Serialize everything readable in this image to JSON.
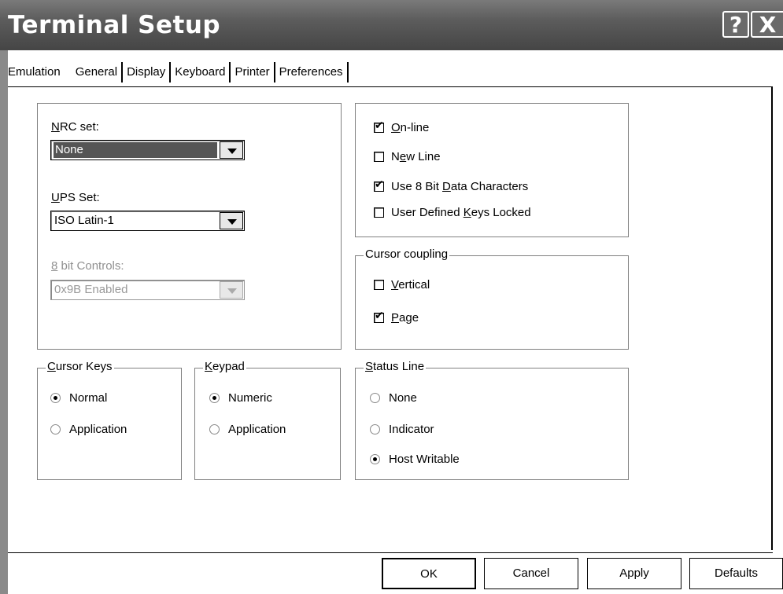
{
  "window": {
    "title": "Terminal Setup",
    "help_label": "?",
    "close_label": "X"
  },
  "tabs": [
    {
      "label": "Emulation",
      "selected": false
    },
    {
      "label": "General",
      "selected": true
    },
    {
      "label": "Display",
      "selected": false
    },
    {
      "label": "Keyboard",
      "selected": false
    },
    {
      "label": "Printer",
      "selected": false
    },
    {
      "label": "Preferences",
      "selected": false
    }
  ],
  "charset": {
    "nrc_label_u": "N",
    "nrc_label_rest": "RC set:",
    "nrc_value": "None",
    "ups_label_u": "U",
    "ups_label_rest": "PS Set:",
    "ups_value": "ISO Latin-1",
    "bit_label_u": "8",
    "bit_label_rest": " bit Controls:",
    "bit_value": "0x9B Enabled"
  },
  "options": {
    "online": {
      "u": "O",
      "rest": "n-line",
      "checked": true
    },
    "newline": {
      "pre": "N",
      "u": "e",
      "rest": "w Line",
      "checked": false
    },
    "use8bit": {
      "pre": "Use 8 Bit ",
      "u": "D",
      "rest": "ata Characters",
      "checked": true
    },
    "udk": {
      "pre": "User Defined ",
      "u": "K",
      "rest": "eys Locked",
      "checked": false
    }
  },
  "cursor_coupling": {
    "title": "Cursor coupling",
    "vertical": {
      "u": "V",
      "rest": "ertical",
      "checked": false
    },
    "page": {
      "u": "P",
      "rest": "age",
      "checked": true
    }
  },
  "cursor_keys": {
    "title_u": "C",
    "title_rest": "ursor Keys",
    "options": [
      {
        "label": "Normal",
        "selected": true
      },
      {
        "label": "Application",
        "selected": false
      }
    ]
  },
  "keypad": {
    "title_u": "K",
    "title_rest": "eypad",
    "options": [
      {
        "label": "Numeric",
        "selected": true
      },
      {
        "label": "Application",
        "selected": false
      }
    ]
  },
  "status_line": {
    "title_u": "S",
    "title_rest": "tatus Line",
    "options": [
      {
        "label": "None",
        "selected": false
      },
      {
        "label": "Indicator",
        "selected": false
      },
      {
        "label": "Host Writable",
        "selected": true
      }
    ]
  },
  "buttons": {
    "ok": "OK",
    "cancel": "Cancel",
    "apply": "Apply",
    "defaults": "Defaults"
  }
}
